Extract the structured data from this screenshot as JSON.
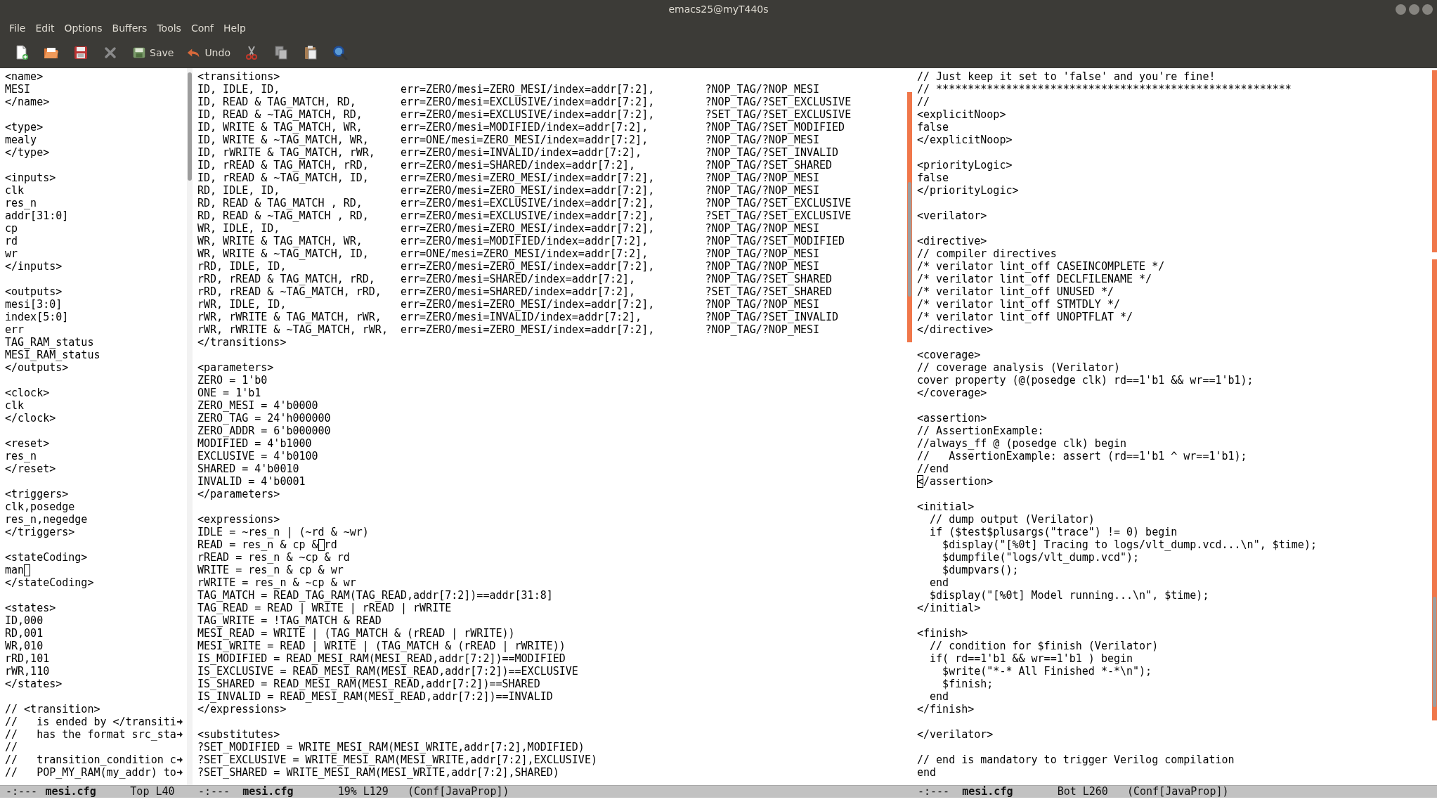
{
  "window": {
    "title": "emacs25@myT440s"
  },
  "menu": [
    "File",
    "Edit",
    "Options",
    "Buffers",
    "Tools",
    "Conf",
    "Help"
  ],
  "toolbar": [
    {
      "kind": "new"
    },
    {
      "kind": "open"
    },
    {
      "kind": "write"
    },
    {
      "kind": "close"
    },
    {
      "kind": "save",
      "label": "Save"
    },
    {
      "kind": "undo",
      "label": "Undo"
    },
    {
      "kind": "cut"
    },
    {
      "kind": "copy"
    },
    {
      "kind": "paste"
    },
    {
      "kind": "search"
    }
  ],
  "panes": [
    {
      "lines": [
        "<name>",
        "MESI",
        "</name>",
        {
          "kind": "blank"
        },
        "<type>",
        "mealy",
        "</type>",
        {
          "kind": "blank"
        },
        "<inputs>",
        "clk",
        "res_n",
        "addr[31:0]",
        "cp",
        "rd",
        "wr",
        "</inputs>",
        {
          "kind": "blank"
        },
        "<outputs>",
        "mesi[3:0]",
        "index[5:0]",
        "err",
        "TAG_RAM_status",
        "MESI_RAM_status",
        "</outputs>",
        {
          "kind": "blank"
        },
        "<clock>",
        "clk",
        "</clock>",
        {
          "kind": "blank"
        },
        "<reset>",
        "res_n",
        "</reset>",
        {
          "kind": "blank"
        },
        "<triggers>",
        "clk,posedge",
        "res_n,negedge",
        "</triggers>",
        {
          "kind": "blank"
        },
        "<stateCoding>",
        {
          "kind": "cursor",
          "before": "man"
        },
        "</stateCoding>",
        {
          "kind": "blank"
        },
        "<states>",
        "ID,000",
        "RD,001",
        "WR,010",
        "rRD,101",
        "rWR,110",
        "</states>",
        {
          "kind": "blank"
        },
        "// <transition>",
        {
          "kind": "truncated",
          "text": "//   is ended by </transiti"
        },
        {
          "kind": "truncated",
          "text": "//   has the format src_sta"
        },
        "//",
        {
          "kind": "truncated",
          "text": "//   transition_condition c"
        },
        {
          "kind": "truncated",
          "text": "//   POP_MY_RAM(my_addr) to"
        }
      ],
      "mode_line": {
        "state": "-:---",
        "buffer": "mesi.cfg",
        "position": "Top L40"
      }
    },
    {
      "lines": [
        "<transitions>",
        {
          "kind": "columns",
          "cells": [
            "ID, IDLE, ID,",
            "err=ZERO/mesi=ZERO_MESI/index=addr[7:2],",
            "?NOP_TAG/?NOP_MESI"
          ]
        },
        {
          "kind": "columns",
          "cells": [
            "ID, READ & TAG_MATCH, RD,",
            "err=ZERO/mesi=EXCLUSIVE/index=addr[7:2],",
            "?NOP_TAG/?SET_EXCLUSIVE"
          ]
        },
        {
          "kind": "columns",
          "cells": [
            "ID, READ & ~TAG_MATCH, RD,",
            "err=ZERO/mesi=EXCLUSIVE/index=addr[7:2],",
            "?SET_TAG/?SET_EXCLUSIVE"
          ]
        },
        {
          "kind": "columns",
          "cells": [
            "ID, WRITE & TAG_MATCH, WR,",
            "err=ZERO/mesi=MODIFIED/index=addr[7:2],",
            "?NOP_TAG/?SET_MODIFIED"
          ]
        },
        {
          "kind": "columns",
          "cells": [
            "ID, WRITE & ~TAG_MATCH, WR,",
            "err=ONE/mesi=ZERO_MESI/index=addr[7:2],",
            "?NOP_TAG/?NOP_MESI"
          ]
        },
        {
          "kind": "columns",
          "cells": [
            "ID, rWRITE & TAG_MATCH, rWR,",
            "err=ZERO/mesi=INVALID/index=addr[7:2],",
            "?NOP_TAG/?SET_INVALID"
          ]
        },
        {
          "kind": "columns",
          "cells": [
            "ID, rREAD & TAG_MATCH, rRD,",
            "err=ZERO/mesi=SHARED/index=addr[7:2],",
            "?NOP_TAG/?SET_SHARED"
          ]
        },
        {
          "kind": "columns",
          "cells": [
            "ID, rREAD & ~TAG_MATCH, ID,",
            "err=ZERO/mesi=ZERO_MESI/index=addr[7:2],",
            "?NOP_TAG/?NOP_MESI"
          ]
        },
        {
          "kind": "columns",
          "cells": [
            "RD, IDLE, ID,",
            "err=ZERO/mesi=ZERO_MESI/index=addr[7:2],",
            "?NOP_TAG/?NOP_MESI"
          ]
        },
        {
          "kind": "columns",
          "cells": [
            "RD, READ & TAG_MATCH , RD,",
            "err=ZERO/mesi=EXCLUSIVE/index=addr[7:2],",
            "?NOP_TAG/?SET_EXCLUSIVE"
          ]
        },
        {
          "kind": "columns",
          "cells": [
            "RD, READ & ~TAG_MATCH , RD,",
            "err=ZERO/mesi=EXCLUSIVE/index=addr[7:2],",
            "?SET_TAG/?SET_EXCLUSIVE"
          ]
        },
        {
          "kind": "columns",
          "cells": [
            "WR, IDLE, ID,",
            "err=ZERO/mesi=ZERO_MESI/index=addr[7:2],",
            "?NOP_TAG/?NOP_MESI"
          ]
        },
        {
          "kind": "columns",
          "cells": [
            "WR, WRITE & TAG_MATCH, WR,",
            "err=ZERO/mesi=MODIFIED/index=addr[7:2],",
            "?NOP_TAG/?SET_MODIFIED"
          ]
        },
        {
          "kind": "columns",
          "cells": [
            "WR, WRITE & ~TAG_MATCH, ID,",
            "err=ONE/mesi=ZERO_MESI/index=addr[7:2],",
            "?NOP_TAG/?NOP_MESI"
          ]
        },
        {
          "kind": "columns",
          "cells": [
            "rRD, IDLE, ID,",
            "err=ZERO/mesi=ZERO_MESI/index=addr[7:2],",
            "?NOP_TAG/?NOP_MESI"
          ]
        },
        {
          "kind": "columns",
          "cells": [
            "rRD, rREAD & TAG_MATCH, rRD,",
            "err=ZERO/mesi=SHARED/index=addr[7:2],",
            "?NOP_TAG/?SET_SHARED"
          ]
        },
        {
          "kind": "columns",
          "cells": [
            "rRD, rREAD & ~TAG_MATCH, rRD,",
            "err=ZERO/mesi=SHARED/index=addr[7:2],",
            "?SET_TAG/?SET_SHARED"
          ]
        },
        {
          "kind": "columns",
          "cells": [
            "rWR, IDLE, ID,",
            "err=ZERO/mesi=ZERO_MESI/index=addr[7:2],",
            "?NOP_TAG/?NOP_MESI"
          ]
        },
        {
          "kind": "columns",
          "cells": [
            "rWR, rWRITE & TAG_MATCH, rWR,",
            "err=ZERO/mesi=INVALID/index=addr[7:2],",
            "?NOP_TAG/?SET_INVALID"
          ]
        },
        {
          "kind": "columns",
          "cells": [
            "rWR, rWRITE & ~TAG_MATCH, rWR,",
            "err=ZERO/mesi=ZERO_MESI/index=addr[7:2],",
            "?NOP_TAG/?NOP_MESI"
          ]
        },
        "</transitions>",
        {
          "kind": "blank"
        },
        "<parameters>",
        "ZERO = 1'b0",
        "ONE = 1'b1",
        "ZERO_MESI = 4'b0000",
        "ZERO_TAG = 24'h000000",
        "ZERO_ADDR = 6'b000000",
        "MODIFIED = 4'b1000",
        "EXCLUSIVE = 4'b0100",
        "SHARED = 4'b0010",
        "INVALID = 4'b0001",
        "</parameters>",
        {
          "kind": "blank"
        },
        "<expressions>",
        "IDLE = ~res_n | (~rd & ~wr)",
        {
          "kind": "cursor",
          "before": "READ = res_n & cp &",
          "after": "rd"
        },
        "rREAD = res_n & ~cp & rd",
        "WRITE = res_n & cp & wr",
        "rWRITE = res_n & ~cp & wr",
        "TAG_MATCH = READ_TAG_RAM(TAG_READ,addr[7:2])==addr[31:8]",
        "TAG_READ = READ | WRITE | rREAD | rWRITE",
        "TAG_WRITE = !TAG_MATCH & READ",
        "MESI_READ = WRITE | (TAG_MATCH & (rREAD | rWRITE))",
        "MESI_WRITE = READ | WRITE | (TAG_MATCH & (rREAD | rWRITE))",
        "IS_MODIFIED = READ_MESI_RAM(MESI_READ,addr[7:2])==MODIFIED",
        "IS_EXCLUSIVE = READ_MESI_RAM(MESI_READ,addr[7:2])==EXCLUSIVE",
        "IS_SHARED = READ_MESI_RAM(MESI_READ,addr[7:2])==SHARED",
        "IS_INVALID = READ_MESI_RAM(MESI_READ,addr[7:2])==INVALID",
        "</expressions>",
        {
          "kind": "blank"
        },
        "<substitutes>",
        "?SET_MODIFIED = WRITE_MESI_RAM(MESI_WRITE,addr[7:2],MODIFIED)",
        "?SET_EXCLUSIVE = WRITE_MESI_RAM(MESI_WRITE,addr[7:2],EXCLUSIVE)",
        "?SET_SHARED = WRITE_MESI_RAM(MESI_WRITE,addr[7:2],SHARED)"
      ],
      "mode_line": {
        "state": "-:---",
        "buffer": "mesi.cfg",
        "position": "19% L129",
        "mode": "(Conf[JavaProp])"
      }
    },
    {
      "lines": [
        "// Just keep it set to 'false' and you're fine!",
        "// ********************************************************",
        "//",
        "<explicitNoop>",
        "false",
        "</explicitNoop>",
        {
          "kind": "blank"
        },
        "<priorityLogic>",
        "false",
        "</priorityLogic>",
        {
          "kind": "blank"
        },
        "<verilator>",
        {
          "kind": "blank"
        },
        "<directive>",
        "// compiler directives",
        "/* verilator lint_off CASEINCOMPLETE */",
        "/* verilator lint_off DECLFILENAME */",
        "/* verilator lint_off UNUSED */",
        "/* verilator lint_off STMTDLY */",
        "/* verilator lint_off UNOPTFLAT */",
        "</directive>",
        {
          "kind": "blank"
        },
        "<coverage>",
        "// coverage analysis (Verilator)",
        "cover property (@(posedge clk) rd==1'b1 && wr==1'b1);",
        "</coverage>",
        {
          "kind": "blank"
        },
        "<assertion>",
        "// AssertionExample:",
        "//always_ff @ (posedge clk) begin",
        "//   AssertionExample: assert (rd==1'b1 ^ wr==1'b1);",
        "//end",
        {
          "kind": "cursor",
          "under": "<",
          "after": "/assertion>"
        },
        {
          "kind": "blank"
        },
        "<initial>",
        "  // dump output (Verilator)",
        "  if ($test$plusargs(\"trace\") != 0) begin",
        "    $display(\"[%0t] Tracing to logs/vlt_dump.vcd...\\n\", $time);",
        "    $dumpfile(\"logs/vlt_dump.vcd\");",
        "    $dumpvars();",
        "  end",
        "  $display(\"[%0t] Model running...\\n\", $time);",
        "</initial>",
        {
          "kind": "blank"
        },
        "<finish>",
        "  // condition for $finish (Verilator)",
        "  if( rd==1'b1 && wr==1'b1 ) begin",
        "    $write(\"*-* All Finished *-*\\n\");",
        "    $finish;",
        "  end",
        "</finish>",
        {
          "kind": "blank"
        },
        "</verilator>",
        {
          "kind": "blank"
        },
        "// end is mandatory to trigger Verilog compilation",
        "end"
      ],
      "mode_line": {
        "state": "-:---",
        "buffer": "mesi.cfg",
        "position": "Bot L260",
        "mode": "(Conf[JavaProp])"
      }
    }
  ]
}
